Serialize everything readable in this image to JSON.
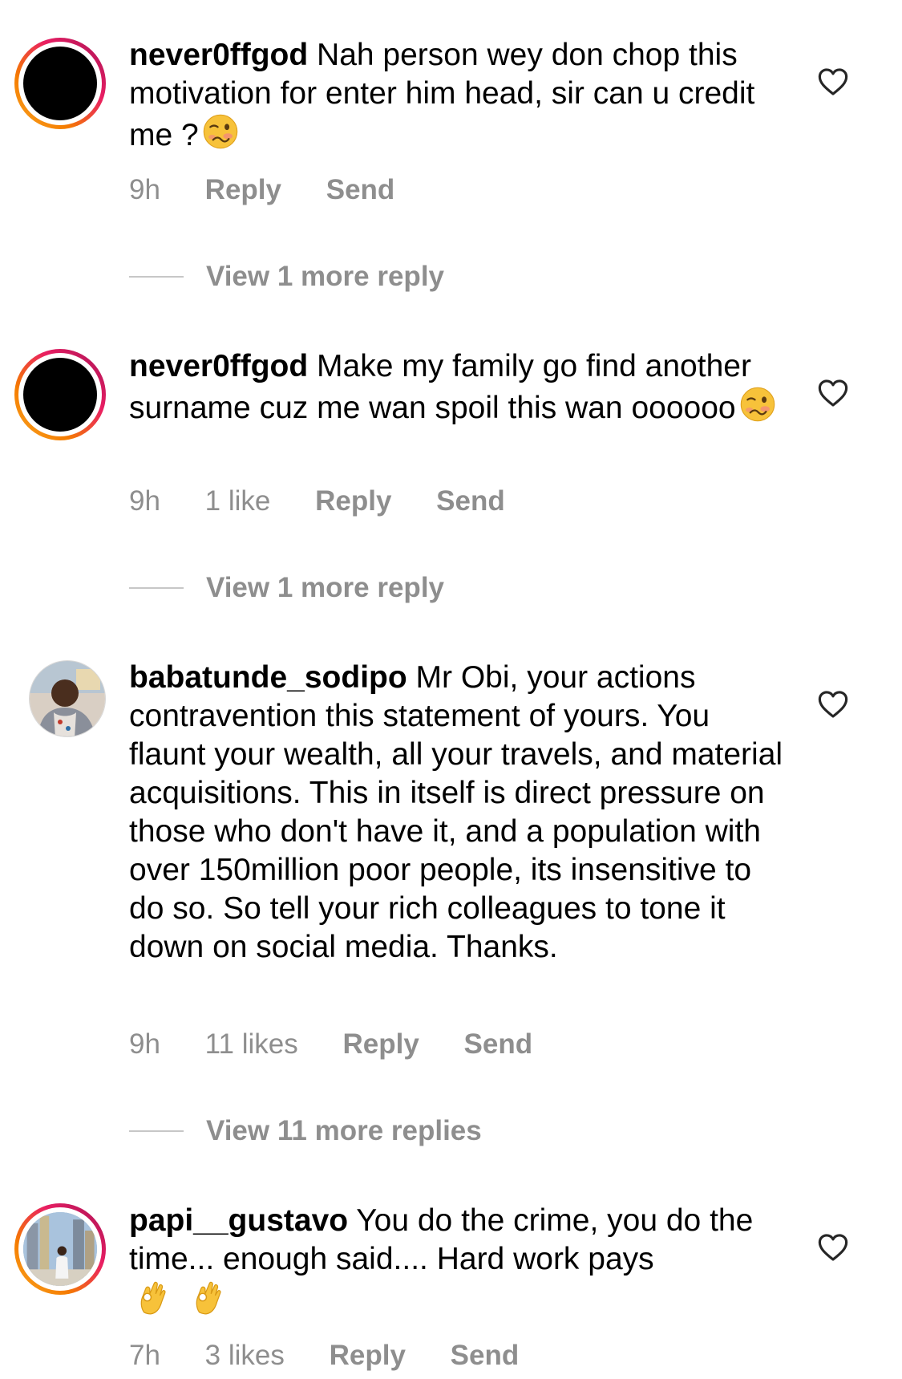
{
  "comments": [
    {
      "username": "never0ffgod",
      "text": "Nah person wey don chop this motivation for enter him head, sir can u credit me ?",
      "emoji": "woozy-face",
      "time": "9h",
      "likes": "",
      "reply_label": "Reply",
      "send_label": "Send",
      "view_more": "View 1 more reply"
    },
    {
      "username": "never0ffgod",
      "text": "Make my family go find another surname cuz me wan spoil this wan oooooo",
      "emoji": "woozy-face",
      "time": "9h",
      "likes": "1 like",
      "reply_label": "Reply",
      "send_label": "Send",
      "view_more": "View 1 more reply"
    },
    {
      "username": "babatunde_sodipo",
      "text": "Mr Obi, your actions contravention this statement of yours. You flaunt your wealth,  all your travels, and material acquisitions. This in itself is direct pressure on those who don't have it, and a population with over 150million poor people, its insensitive to do so. So tell your rich colleagues to tone it down on social media. Thanks.",
      "time": "9h",
      "likes": "11 likes",
      "reply_label": "Reply",
      "send_label": "Send",
      "view_more": "View 11 more replies"
    },
    {
      "username": "papi__gustavo",
      "text": "You do the crime, you do the time... enough said.... Hard work pays",
      "emoji": "ok-hand x2",
      "time": "7h",
      "likes": "3 likes",
      "reply_label": "Reply",
      "send_label": "Send"
    }
  ],
  "colors": {
    "meta_gray": "#8e8e8e",
    "divider": "#c7c7c7",
    "story_ring_start": "#f9a825",
    "story_ring_end": "#a020c8"
  },
  "icons": {
    "like": "heart-outline-icon"
  }
}
